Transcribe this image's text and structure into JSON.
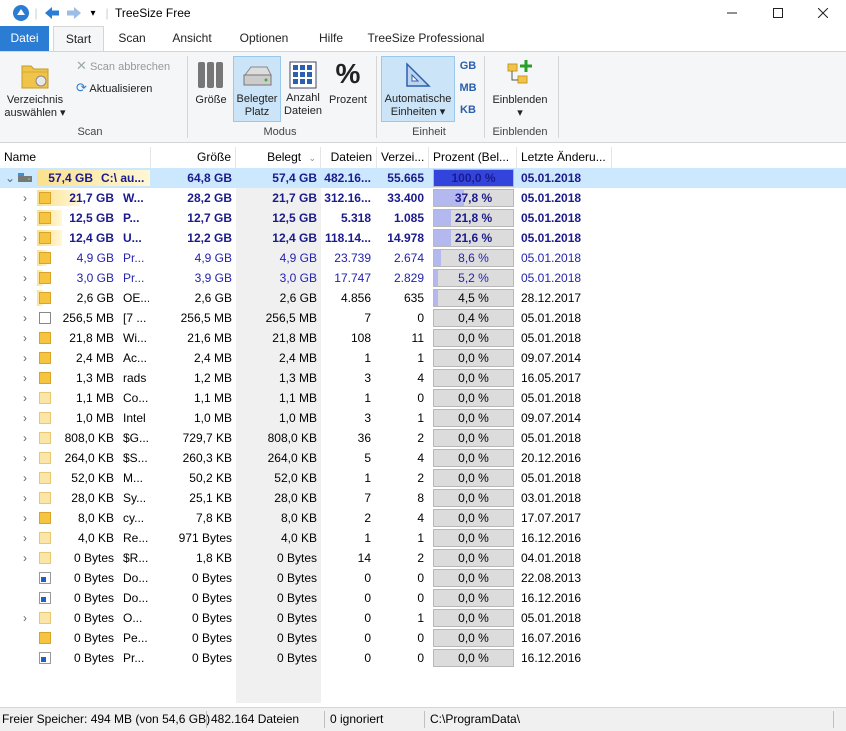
{
  "window": {
    "title": "TreeSize Free"
  },
  "tabs": [
    "Datei",
    "Start",
    "Scan",
    "Ansicht",
    "Optionen",
    "Hilfe",
    "TreeSize Professional"
  ],
  "ribbon": {
    "verzeichnis": "Verzeichnis\nauswählen ▾",
    "scan_abbrechen": "Scan abbrechen",
    "aktualisieren": "Aktualisieren",
    "group_scan": "Scan",
    "groesse": "Größe",
    "belegter_platz": "Belegter\nPlatz",
    "anzahl_dateien": "Anzahl\nDateien",
    "prozent": "Prozent",
    "group_modus": "Modus",
    "auto_einheiten": "Automatische\nEinheiten ▾",
    "unit_gb": "GB",
    "unit_mb": "MB",
    "unit_kb": "KB",
    "group_einheit": "Einheit",
    "einblenden": "Einblenden\n▾",
    "group_einblenden": "Einblenden"
  },
  "columns": [
    "Name",
    "Größe",
    "Belegt",
    "Dateien",
    "Verzei...",
    "Prozent (Bel...",
    "Letzte Änderu..."
  ],
  "rows": [
    {
      "size": "57,4 GB",
      "name": "C:\\ au...",
      "groesse": "64,8 GB",
      "belegt": "57,4 GB",
      "dateien": "482.16...",
      "verz": "55.665",
      "pct": 100.0,
      "pct_label": "100,0 %",
      "date": "05.01.2018",
      "style": "top",
      "icon": "drive",
      "bar": 100
    },
    {
      "size": "21,7 GB",
      "name": "W...",
      "groesse": "28,2 GB",
      "belegt": "21,7 GB",
      "dateien": "312.16...",
      "verz": "33.400",
      "pct": 37.8,
      "pct_label": "37,8 %",
      "date": "05.01.2018",
      "style": "big",
      "icon": "folder",
      "bar": 38
    },
    {
      "size": "12,5 GB",
      "name": "P...",
      "groesse": "12,7 GB",
      "belegt": "12,5 GB",
      "dateien": "5.318",
      "verz": "1.085",
      "pct": 21.8,
      "pct_label": "21,8 %",
      "date": "05.01.2018",
      "style": "big",
      "icon": "folder",
      "bar": 22
    },
    {
      "size": "12,4 GB",
      "name": "U...",
      "groesse": "12,2 GB",
      "belegt": "12,4 GB",
      "dateien": "118.14...",
      "verz": "14.978",
      "pct": 21.6,
      "pct_label": "21,6 %",
      "date": "05.01.2018",
      "style": "big",
      "icon": "folder",
      "bar": 22
    },
    {
      "size": "4,9 GB",
      "name": "Pr...",
      "groesse": "4,9 GB",
      "belegt": "4,9 GB",
      "dateien": "23.739",
      "verz": "2.674",
      "pct": 8.6,
      "pct_label": "8,6 %",
      "date": "05.01.2018",
      "style": "mid",
      "icon": "folder",
      "bar": 9
    },
    {
      "size": "3,0 GB",
      "name": "Pr...",
      "groesse": "3,9 GB",
      "belegt": "3,0 GB",
      "dateien": "17.747",
      "verz": "2.829",
      "pct": 5.2,
      "pct_label": "5,2 %",
      "date": "05.01.2018",
      "style": "mid",
      "icon": "folder",
      "bar": 5
    },
    {
      "size": "2,6 GB",
      "name": "OE...",
      "groesse": "2,6 GB",
      "belegt": "2,6 GB",
      "dateien": "4.856",
      "verz": "635",
      "pct": 4.5,
      "pct_label": "4,5 %",
      "date": "28.12.2017",
      "style": "norm",
      "icon": "folder",
      "bar": 5
    },
    {
      "size": "256,5 MB",
      "name": "[7 ...",
      "groesse": "256,5 MB",
      "belegt": "256,5 MB",
      "dateien": "7",
      "verz": "0",
      "pct": 0.4,
      "pct_label": "0,4 %",
      "date": "05.01.2018",
      "style": "norm",
      "icon": "file",
      "bar": 0
    },
    {
      "size": "21,8 MB",
      "name": "Wi...",
      "groesse": "21,6 MB",
      "belegt": "21,8 MB",
      "dateien": "108",
      "verz": "11",
      "pct": 0.0,
      "pct_label": "0,0 %",
      "date": "05.01.2018",
      "style": "norm",
      "icon": "folder",
      "bar": 0
    },
    {
      "size": "2,4 MB",
      "name": "Ac...",
      "groesse": "2,4 MB",
      "belegt": "2,4 MB",
      "dateien": "1",
      "verz": "1",
      "pct": 0.0,
      "pct_label": "0,0 %",
      "date": "09.07.2014",
      "style": "norm",
      "icon": "folder",
      "bar": 0
    },
    {
      "size": "1,3 MB",
      "name": "rads",
      "groesse": "1,2 MB",
      "belegt": "1,3 MB",
      "dateien": "3",
      "verz": "4",
      "pct": 0.0,
      "pct_label": "0,0 %",
      "date": "16.05.2017",
      "style": "norm",
      "icon": "folder",
      "bar": 0
    },
    {
      "size": "1,1 MB",
      "name": "Co...",
      "groesse": "1,1 MB",
      "belegt": "1,1 MB",
      "dateien": "1",
      "verz": "0",
      "pct": 0.0,
      "pct_label": "0,0 %",
      "date": "05.01.2018",
      "style": "norm",
      "icon": "light",
      "bar": 0
    },
    {
      "size": "1,0 MB",
      "name": "Intel",
      "groesse": "1,0 MB",
      "belegt": "1,0 MB",
      "dateien": "3",
      "verz": "1",
      "pct": 0.0,
      "pct_label": "0,0 %",
      "date": "09.07.2014",
      "style": "norm",
      "icon": "light",
      "bar": 0
    },
    {
      "size": "808,0 KB",
      "name": "$G...",
      "groesse": "729,7 KB",
      "belegt": "808,0 KB",
      "dateien": "36",
      "verz": "2",
      "pct": 0.0,
      "pct_label": "0,0 %",
      "date": "05.01.2018",
      "style": "norm",
      "icon": "light",
      "bar": 0
    },
    {
      "size": "264,0 KB",
      "name": "$S...",
      "groesse": "260,3 KB",
      "belegt": "264,0 KB",
      "dateien": "5",
      "verz": "4",
      "pct": 0.0,
      "pct_label": "0,0 %",
      "date": "20.12.2016",
      "style": "norm",
      "icon": "light",
      "bar": 0
    },
    {
      "size": "52,0 KB",
      "name": "M...",
      "groesse": "50,2 KB",
      "belegt": "52,0 KB",
      "dateien": "1",
      "verz": "2",
      "pct": 0.0,
      "pct_label": "0,0 %",
      "date": "05.01.2018",
      "style": "norm",
      "icon": "light",
      "bar": 0
    },
    {
      "size": "28,0 KB",
      "name": "Sy...",
      "groesse": "25,1 KB",
      "belegt": "28,0 KB",
      "dateien": "7",
      "verz": "8",
      "pct": 0.0,
      "pct_label": "0,0 %",
      "date": "03.01.2018",
      "style": "norm",
      "icon": "light",
      "bar": 0
    },
    {
      "size": "8,0 KB",
      "name": "cy...",
      "groesse": "7,8 KB",
      "belegt": "8,0 KB",
      "dateien": "2",
      "verz": "4",
      "pct": 0.0,
      "pct_label": "0,0 %",
      "date": "17.07.2017",
      "style": "norm",
      "icon": "folder",
      "bar": 0
    },
    {
      "size": "4,0 KB",
      "name": "Re...",
      "groesse": "971 Bytes",
      "belegt": "4,0 KB",
      "dateien": "1",
      "verz": "1",
      "pct": 0.0,
      "pct_label": "0,0 %",
      "date": "16.12.2016",
      "style": "norm",
      "icon": "light",
      "bar": 0
    },
    {
      "size": "0 Bytes",
      "name": "$R...",
      "groesse": "1,8 KB",
      "belegt": "0 Bytes",
      "dateien": "14",
      "verz": "2",
      "pct": 0.0,
      "pct_label": "0,0 %",
      "date": "04.01.2018",
      "style": "norm",
      "icon": "light",
      "bar": 0
    },
    {
      "size": "0 Bytes",
      "name": "Do...",
      "groesse": "0 Bytes",
      "belegt": "0 Bytes",
      "dateien": "0",
      "verz": "0",
      "pct": 0.0,
      "pct_label": "0,0 %",
      "date": "22.08.2013",
      "style": "norm",
      "icon": "link",
      "bar": 0,
      "noarrow": true
    },
    {
      "size": "0 Bytes",
      "name": "Do...",
      "groesse": "0 Bytes",
      "belegt": "0 Bytes",
      "dateien": "0",
      "verz": "0",
      "pct": 0.0,
      "pct_label": "0,0 %",
      "date": "16.12.2016",
      "style": "norm",
      "icon": "link",
      "bar": 0,
      "noarrow": true
    },
    {
      "size": "0 Bytes",
      "name": "O...",
      "groesse": "0 Bytes",
      "belegt": "0 Bytes",
      "dateien": "0",
      "verz": "1",
      "pct": 0.0,
      "pct_label": "0,0 %",
      "date": "05.01.2018",
      "style": "norm",
      "icon": "light",
      "bar": 0
    },
    {
      "size": "0 Bytes",
      "name": "Pe...",
      "groesse": "0 Bytes",
      "belegt": "0 Bytes",
      "dateien": "0",
      "verz": "0",
      "pct": 0.0,
      "pct_label": "0,0 %",
      "date": "16.07.2016",
      "style": "norm",
      "icon": "folder",
      "bar": 0,
      "noarrow": true
    },
    {
      "size": "0 Bytes",
      "name": "Pr...",
      "groesse": "0 Bytes",
      "belegt": "0 Bytes",
      "dateien": "0",
      "verz": "0",
      "pct": 0.0,
      "pct_label": "0,0 %",
      "date": "16.12.2016",
      "style": "norm",
      "icon": "link",
      "bar": 0,
      "noarrow": true
    }
  ],
  "status": {
    "free": "Freier Speicher: 494 MB  (von 54,6 GB)",
    "files": "482.164  Dateien",
    "ignored": "0 ignoriert",
    "path": "C:\\ProgramData\\"
  },
  "colors": {
    "accent": "#2b7cd3",
    "selection": "#cce8ff",
    "bar_top": "#3344dd",
    "bar": "#b3b8ee"
  }
}
